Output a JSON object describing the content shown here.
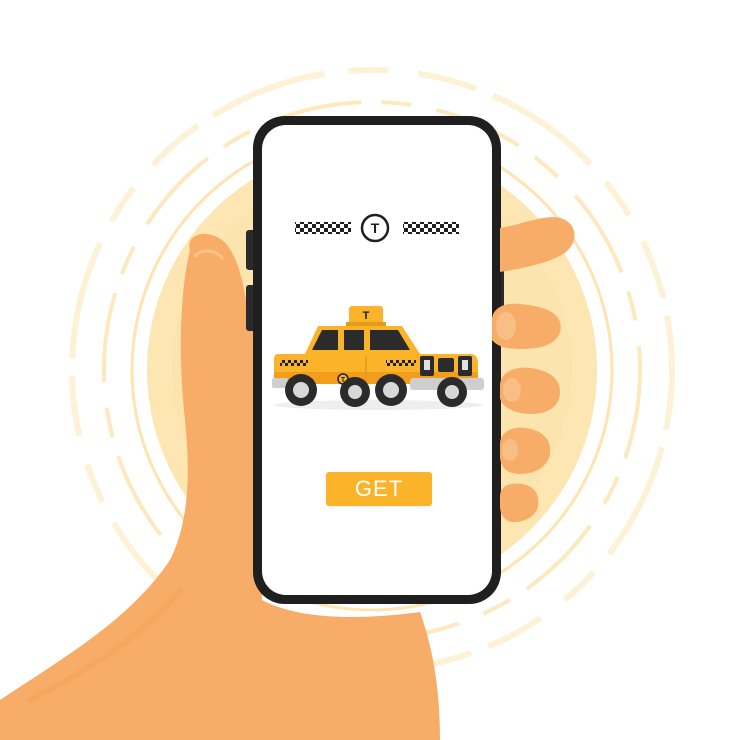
{
  "screen": {
    "header_emblem_letter": "T",
    "taxi_roof_sign_letter": "T",
    "taxi_door_letter": "T",
    "cta_label": "GET"
  },
  "icons": {
    "emblem": "taxi-emblem-icon",
    "vehicle": "taxi-car-icon",
    "checker_pattern": "checker-stripe-icon"
  },
  "colors": {
    "accent": "#fbb42a",
    "taxi_body": "#fbb42a",
    "skin": "#f7ad67",
    "halo": "#fde6b1",
    "phone_frame": "#1f1f1f",
    "screen_bg": "#ffffff"
  }
}
